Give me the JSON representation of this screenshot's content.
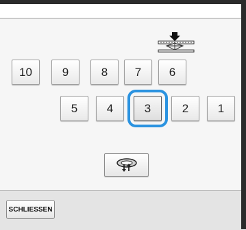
{
  "needle_bar": {
    "buttons_row1": [
      "10",
      "9",
      "8",
      "7",
      "6"
    ],
    "buttons_row2": [
      "5",
      "4",
      "3",
      "2",
      "1"
    ],
    "selected": "3"
  },
  "icons": {
    "needle_indicator": "needle-position-icon",
    "rotate": "rotate-needle-bar-icon"
  },
  "footer": {
    "close_label": "SCHLIESSEN"
  },
  "colors": {
    "selection_ring": "#2b93e0",
    "panel_bg": "#f6f6f6",
    "footer_bg": "#e4e4e4"
  }
}
